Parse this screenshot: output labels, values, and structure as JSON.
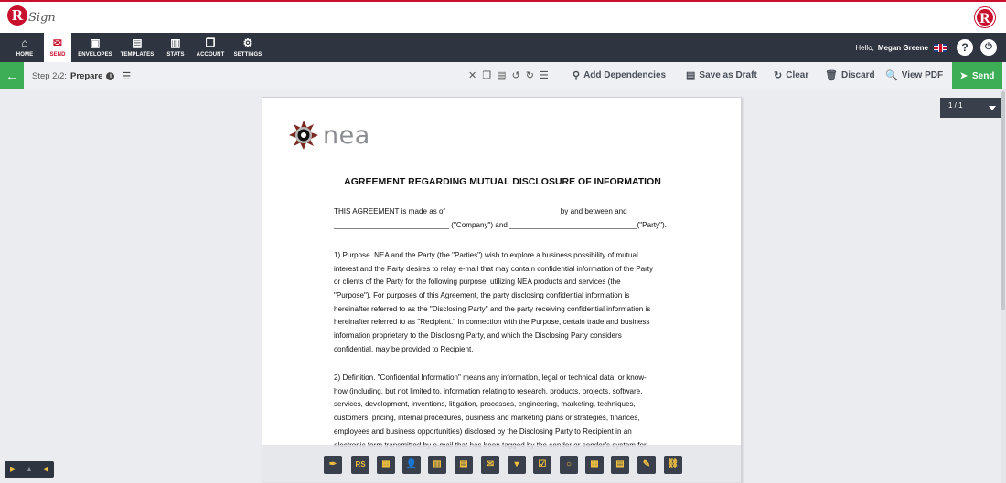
{
  "app": {
    "name": "RSign",
    "logo_letter": "R",
    "logo_word": "Sign",
    "brand_color": "#c8102e"
  },
  "nav": {
    "items": [
      {
        "label": "HOME",
        "icon": "home-icon"
      },
      {
        "label": "SEND",
        "icon": "envelope-icon",
        "active": true
      },
      {
        "label": "ENVELOPES",
        "icon": "envelopes-icon"
      },
      {
        "label": "TEMPLATES",
        "icon": "templates-icon"
      },
      {
        "label": "STATS",
        "icon": "briefcase-icon"
      },
      {
        "label": "ACCOUNT",
        "icon": "account-icon"
      },
      {
        "label": "SETTINGS",
        "icon": "gear-icon"
      }
    ],
    "greeting": "Hello,",
    "user_name": "Megan Greene",
    "help": "?",
    "power": "⏻"
  },
  "toolbar": {
    "step_label": "Step 2/2:",
    "step_name": "Prepare",
    "add_dependencies": "Add Dependencies",
    "save_as_draft": "Save as Draft",
    "clear": "Clear",
    "discard": "Discard",
    "view_pdf": "View PDF",
    "send": "Send",
    "accent": "#3dad56"
  },
  "page_selector": {
    "value": "1 / 1"
  },
  "document": {
    "company_logo_text": "nea",
    "title": "AGREEMENT REGARDING MUTUAL DISCLOSURE OF INFORMATION",
    "lines": [
      "THIS AGREEMENT is made as of ___________________________ by and between and",
      "____________________________ (\"Company\") and _______________________________(\"Party\").",
      "1) Purpose.  NEA and the Party (the \"Parties\") wish to explore a business possibility of mutual",
      "interest and the Party desires to relay e-mail that may contain confidential information of the Party",
      "or clients of the Party for the following purpose: utilizing NEA products and services (the",
      "\"Purpose\").  For purposes of this Agreement, the party disclosing confidential information is",
      "hereinafter referred to as the \"Disclosing Party\" and the party receiving confidential information is",
      "hereinafter referred to as \"Recipient.\"  In connection with the Purpose, certain trade and business",
      "information proprietary to the Disclosing Party, and which the Disclosing Party considers",
      "confidential, may be provided to Recipient.",
      "2) Definition.  \"Confidential Information\" means any information, legal or technical data, or know-",
      "how (including, but not limited to, information relating to research, products, projects, software,",
      "services, development, inventions, litigation, processes, engineering, marketing, techniques,",
      "customers, pricing, internal procedures, business and marketing plans or strategies, finances,",
      "employees and business opportunities) disclosed by the Disclosing Party to Recipient in an",
      "electronic form transmitted by e-mail that has been tagged by the sender or sender's system for"
    ]
  },
  "field_toolbar": {
    "buttons": [
      {
        "name": "signature-field-button",
        "glyph": "✒"
      },
      {
        "name": "initials-field-button",
        "glyph": "RS"
      },
      {
        "name": "stamp-field-button",
        "glyph": "▦"
      },
      {
        "name": "name-field-button",
        "glyph": "👤"
      },
      {
        "name": "title-field-button",
        "glyph": "▥"
      },
      {
        "name": "company-field-button",
        "glyph": "▤"
      },
      {
        "name": "email-field-button",
        "glyph": "✉"
      },
      {
        "name": "dropdown-field-button",
        "glyph": "▾"
      },
      {
        "name": "checkbox-field-button",
        "glyph": "☑"
      },
      {
        "name": "radio-field-button",
        "glyph": "○"
      },
      {
        "name": "date-field-button",
        "glyph": "▦"
      },
      {
        "name": "text-field-button",
        "glyph": "▤"
      },
      {
        "name": "label-field-button",
        "glyph": "✎"
      },
      {
        "name": "hyperlink-field-button",
        "glyph": "⛓"
      }
    ]
  },
  "player": {
    "play": "▶",
    "up": "▲",
    "prev": "◀"
  }
}
